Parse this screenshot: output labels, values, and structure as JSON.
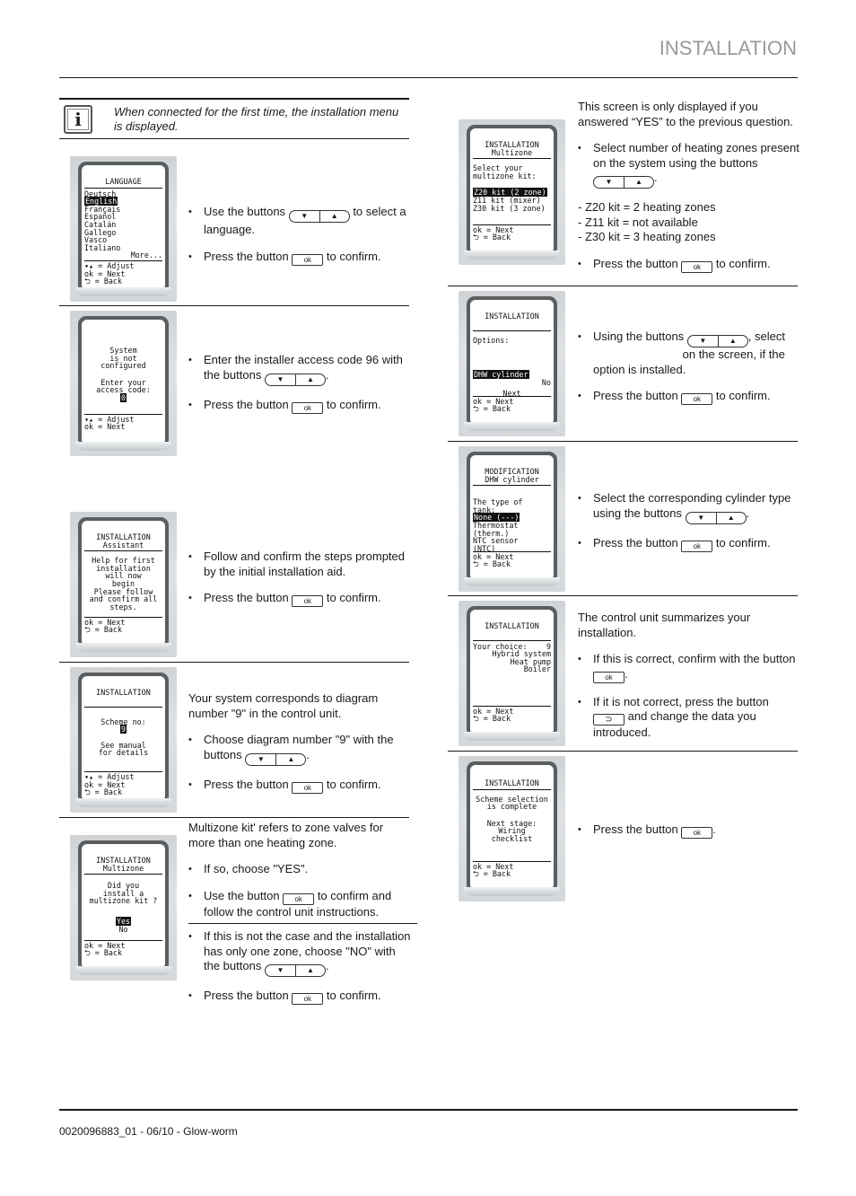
{
  "header": {
    "section_title": "INSTALLATION"
  },
  "footer": {
    "doc_ref": "0020096883_01 - 06/10 - Glow-worm"
  },
  "note": {
    "icon": "info-icon",
    "glyph": "i",
    "text": "When connected for the first time, the installation menu is displayed."
  },
  "controls": {
    "down_glyph": "▼",
    "up_glyph": "▲",
    "ok_label": "ok",
    "back_glyph": "⊃"
  },
  "screens": {
    "language": {
      "title": "LANGUAGE",
      "items": [
        "Deutsch",
        "English",
        "Français",
        "Español",
        "Catalán",
        "Gallego",
        "Vasco",
        "Italiano"
      ],
      "selected": "English",
      "more": "More...",
      "legend": [
        "▾▴ = Adjust",
        "ok = Next",
        "⮌ = Back"
      ]
    },
    "access": {
      "lines": [
        "System",
        "is not",
        "configured"
      ],
      "prompt": [
        "Enter your",
        "access code:"
      ],
      "value": "0",
      "legend": [
        "▾▴ = Adjust",
        "ok = Next"
      ]
    },
    "assistant": {
      "title": "INSTALLATION",
      "subtitle": "Assistant",
      "lines": [
        "Help for first",
        "installation",
        "will now",
        "begin",
        "Please follow",
        "and confirm all",
        "steps."
      ],
      "legend": [
        "ok = Next",
        "⮌ = Back"
      ]
    },
    "scheme": {
      "title": "INSTALLATION",
      "label": "Scheme no:",
      "value": "9",
      "note": [
        "See manual",
        "for details"
      ],
      "legend": [
        "▾▴ = Adjust",
        "ok = Next",
        "⮌ = Back"
      ]
    },
    "multizone_question": {
      "title": "INSTALLATION",
      "subtitle": "Multizone",
      "lines": [
        "Did you",
        "install a",
        "multizone kit ?"
      ],
      "options": [
        "Yes",
        "No"
      ],
      "selected": "Yes",
      "legend": [
        "ok = Next",
        "⮌ = Back"
      ]
    },
    "multizone_kit": {
      "title": "INSTALLATION",
      "subtitle": "Multizone",
      "prompt": [
        "Select your",
        "multizone kit:"
      ],
      "options": [
        "Z20 kit (2 zone)",
        "Z11 kit (mixer)",
        "Z30 kit (3 zone)"
      ],
      "selected": "Z20 kit (2 zone)",
      "legend": [
        "ok = Next",
        "⮌ = Back"
      ]
    },
    "options": {
      "title": "INSTALLATION",
      "label": "Options:",
      "item": "DHW cylinder",
      "item_value": "No",
      "next": "Next",
      "legend": [
        "ok = Next",
        "⮌ = Back"
      ]
    },
    "dhw_modification": {
      "title": "MODIFICATION",
      "subtitle": "DHW cylinder",
      "prompt": [
        "The type of",
        "tank:"
      ],
      "options": [
        "None (---)",
        "Thermostat",
        "(therm.)",
        "NTC sensor",
        "(NTC)"
      ],
      "selected": "None (---)",
      "legend": [
        "ok = Next",
        "⮌ = Back"
      ]
    },
    "summary": {
      "title": "INSTALLATION",
      "choice_label": "Your choice:",
      "choice_value": "9",
      "lines": [
        "Hybrid system",
        "Heat pump",
        "Boiler"
      ],
      "legend": [
        "ok = Next",
        "⮌ = Back"
      ]
    },
    "complete": {
      "title": "INSTALLATION",
      "lines": [
        "Scheme selection",
        "is complete"
      ],
      "next": [
        "Next stage:",
        "Wiring",
        "checklist"
      ],
      "legend": [
        "ok = Next",
        "⮌ = Back"
      ]
    }
  },
  "steps": {
    "language": {
      "b1_pre": "Use the buttons",
      "b1_post": "to select a language.",
      "b2_pre": "Press the button",
      "b2_post": "to confirm."
    },
    "access": {
      "b1_pre": "Enter the installer access code 96 with the buttons",
      "b1_post": ".",
      "b2_pre": "Press the button",
      "b2_post": "to confirm."
    },
    "assistant": {
      "b1": "Follow and confirm the steps prompted by the initial installation aid.",
      "b2_pre": "Press the button",
      "b2_post": "to confirm."
    },
    "scheme": {
      "intro": "Your system corresponds to diagram number \"9\" in the control unit.",
      "b1_pre": "Choose diagram number \"9\" with the buttons",
      "b1_post": ".",
      "b2_pre": "Press the button",
      "b2_post": "to confirm."
    },
    "multizone_question": {
      "intro": "Multizone kit' refers to zone valves for more than one heating zone.",
      "b1": "If so, choose \"YES\".",
      "b2_pre": "Use the button",
      "b2_post": "to confirm and follow the control unit instructions.",
      "b3_pre": "If this is not the case and the installation has only one zone, choose \"NO\" with the buttons",
      "b3_post": ".",
      "b4_pre": "Press the button",
      "b4_post": "to confirm."
    },
    "multizone_kit": {
      "intro": "This screen is only displayed if you answered “YES” to the previous question.",
      "b1_pre": "Select number of heating zones present on the system using the buttons",
      "b1_post": ".",
      "kits": [
        "- Z20 kit = 2 heating zones",
        "- Z11 kit = not available",
        "- Z30 kit = 3 heating zones"
      ],
      "b2_pre": "Press the button",
      "b2_post": "to confirm."
    },
    "options": {
      "b1_pre": "Using the buttons",
      "b1_mid": ", select",
      "b1_post": "on the screen, if the option is installed.",
      "b2_pre": "Press the button",
      "b2_post": "to confirm."
    },
    "dhw_modification": {
      "b1_pre": "Select the corresponding cylinder type using the buttons",
      "b1_post": ".",
      "b2_pre": "Press the button",
      "b2_post": "to confirm."
    },
    "summary": {
      "intro": "The control unit summarizes your installation.",
      "b1_pre": "If this is correct, confirm with the button",
      "b1_post": ".",
      "b2_pre": "If it is not correct, press the button",
      "b2_post": "and change the data you introduced."
    },
    "complete": {
      "b1_pre": "Press the button",
      "b1_post": "."
    }
  }
}
